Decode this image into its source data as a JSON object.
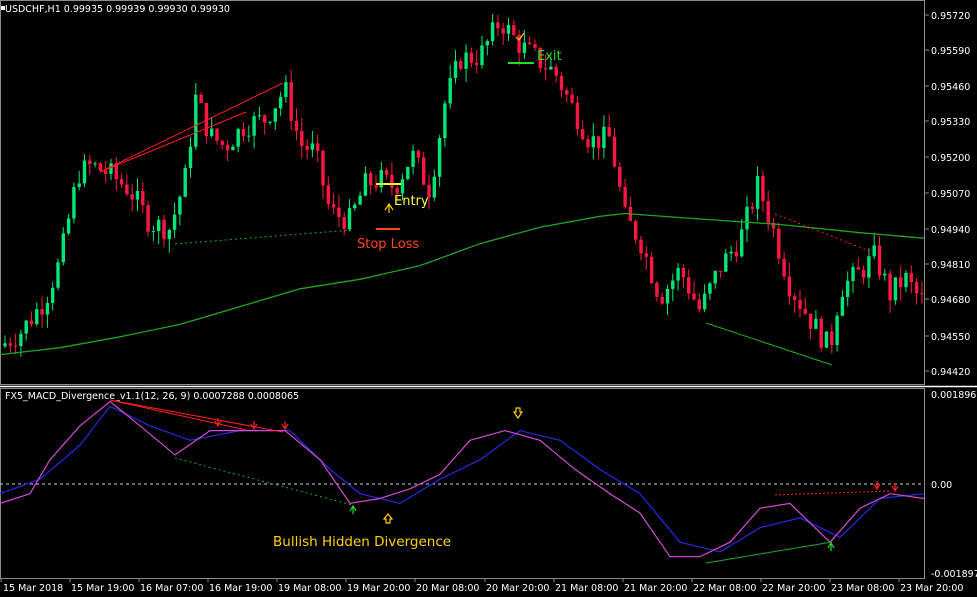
{
  "main_header": "USDCHF,H1  0.99935 0.99939 0.99930 0.99930",
  "indicator_header": "FX5_MACD_Divergence_v1.1(12, 26, 9) 0.0007288 0.0008065",
  "price_axis": [
    "0.95720",
    "0.95590",
    "0.95460",
    "0.95330",
    "0.95200",
    "0.95070",
    "0.94940",
    "0.94810",
    "0.94680",
    "0.94550",
    "0.94420"
  ],
  "indicator_axis": {
    "top": "0.0018965",
    "zero": "0.00",
    "bottom": "-0.001897"
  },
  "time_axis": [
    "15 Mar 2018",
    "15 Mar 19:00",
    "16 Mar 07:00",
    "16 Mar 19:00",
    "19 Mar 08:00",
    "19 Mar 20:00",
    "20 Mar 08:00",
    "20 Mar 20:00",
    "21 Mar 08:00",
    "21 Mar 20:00",
    "22 Mar 08:00",
    "22 Mar 20:00",
    "23 Mar 08:00",
    "23 Mar 20:00"
  ],
  "annotations": {
    "entry": "Entry",
    "exit": "Exit",
    "stop_loss": "Stop Loss",
    "divergence": "Bullish Hidden Divergence"
  },
  "colors": {
    "background": "#000000",
    "bull_candle": "#00e676",
    "bear_candle": "#ff1744",
    "ma_line": "#1fa51f",
    "macd_line": "#d24bd2",
    "signal_line": "#2a2ae0",
    "bearish_div": "#ff2020",
    "bullish_div": "#1faa1f",
    "axis_text": "#ffffff",
    "entry_text": "#ffff33",
    "exit_text": "#22dd22",
    "stop_text": "#ff4422",
    "divergence_text": "#ffd000"
  },
  "chart_data": {
    "type": "candlestick",
    "symbol": "USDCHF",
    "timeframe": "H1",
    "price_range": [
      0.9439,
      0.9578
    ],
    "moving_average_path": [
      [
        0,
        0.9448
      ],
      [
        60,
        0.94505
      ],
      [
        120,
        0.94545
      ],
      [
        180,
        0.9459
      ],
      [
        240,
        0.94655
      ],
      [
        300,
        0.9472
      ],
      [
        360,
        0.94755
      ],
      [
        420,
        0.94805
      ],
      [
        480,
        0.94885
      ],
      [
        540,
        0.94945
      ],
      [
        600,
        0.94985
      ],
      [
        625,
        0.94995
      ],
      [
        700,
        0.94975
      ],
      [
        780,
        0.94955
      ],
      [
        860,
        0.94925
      ],
      [
        924,
        0.94905
      ]
    ],
    "macd_range": [
      -0.001897,
      0.0018965
    ],
    "macd_line": [
      [
        0,
        -0.0004
      ],
      [
        30,
        -0.0002
      ],
      [
        50,
        0.0005
      ],
      [
        80,
        0.0012
      ],
      [
        110,
        0.0017
      ],
      [
        140,
        0.0012
      ],
      [
        175,
        0.0006
      ],
      [
        210,
        0.0011
      ],
      [
        250,
        0.0011
      ],
      [
        285,
        0.0011
      ],
      [
        320,
        0.0005
      ],
      [
        350,
        -0.0004
      ],
      [
        380,
        -0.0003
      ],
      [
        410,
        -0.0001
      ],
      [
        440,
        0.0002
      ],
      [
        470,
        0.0009
      ],
      [
        505,
        0.0011
      ],
      [
        540,
        0.0009
      ],
      [
        575,
        0.0003
      ],
      [
        610,
        -0.0002
      ],
      [
        640,
        -0.0006
      ],
      [
        670,
        -0.0015
      ],
      [
        700,
        -0.0015
      ],
      [
        730,
        -0.0012
      ],
      [
        760,
        -0.0005
      ],
      [
        790,
        -0.0004
      ],
      [
        830,
        -0.0012
      ],
      [
        860,
        -0.0005
      ],
      [
        890,
        -0.0002
      ],
      [
        924,
        -0.0003
      ]
    ],
    "signal_line": [
      [
        0,
        -0.0002
      ],
      [
        40,
        0.0001
      ],
      [
        80,
        0.0008
      ],
      [
        110,
        0.0016
      ],
      [
        150,
        0.0012
      ],
      [
        190,
        0.0009
      ],
      [
        240,
        0.0011
      ],
      [
        290,
        0.0011
      ],
      [
        330,
        0.0003
      ],
      [
        360,
        -0.0002
      ],
      [
        400,
        -0.0004
      ],
      [
        440,
        0.0001
      ],
      [
        480,
        0.0005
      ],
      [
        520,
        0.0011
      ],
      [
        560,
        0.0009
      ],
      [
        600,
        0.0003
      ],
      [
        640,
        -0.0002
      ],
      [
        680,
        -0.0012
      ],
      [
        720,
        -0.0014
      ],
      [
        760,
        -0.0009
      ],
      [
        800,
        -0.0007
      ],
      [
        840,
        -0.0011
      ],
      [
        880,
        -0.0003
      ],
      [
        924,
        -0.0002
      ]
    ]
  }
}
